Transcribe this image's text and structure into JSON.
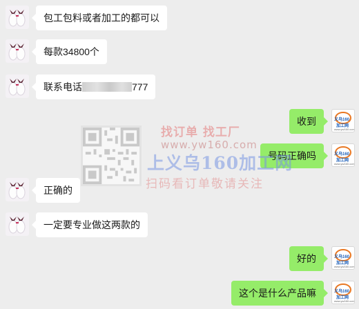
{
  "messages": [
    {
      "side": "left",
      "text": "包工包料或者加工的都可以"
    },
    {
      "side": "left",
      "text": "每款34800个"
    },
    {
      "side": "left",
      "text_prefix": "联系电话",
      "text_suffix": "777"
    },
    {
      "side": "right",
      "text": "收到"
    },
    {
      "side": "right",
      "text": "号码正确吗"
    },
    {
      "side": "left",
      "text": "正确的"
    },
    {
      "side": "left",
      "text": "一定要专业做这两款的"
    },
    {
      "side": "right",
      "text": "好的"
    },
    {
      "side": "right",
      "text": "这个是什么产品嘛"
    }
  ],
  "right_avatar": {
    "logo_line1": "义乌160",
    "logo_line2": "加工网",
    "logo_url": "www.yw160.com"
  },
  "watermark": {
    "line1": "找订单 找工厂",
    "line2": "www.yw160.com",
    "line3": "上义乌160加工网",
    "line4": "扫码看订单敬请关注"
  },
  "colors": {
    "background": "#ededed",
    "bubble_self": "#95ec69",
    "bubble_other": "#ffffff"
  }
}
